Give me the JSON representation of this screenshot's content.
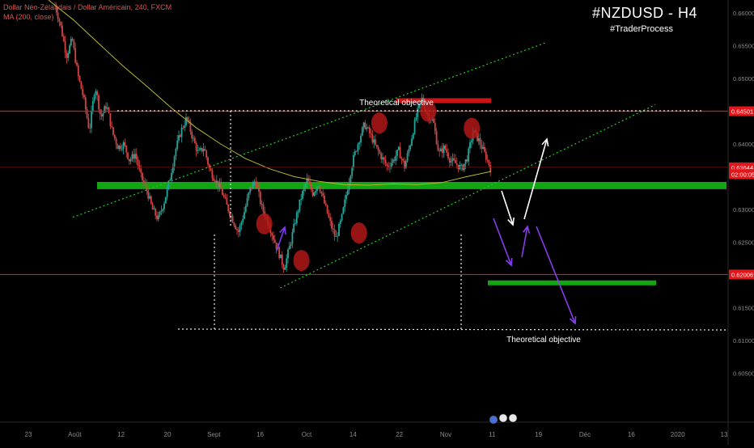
{
  "header": {
    "instrument_line": "Dollar Néo-Zélandais / Dollar Américain, 240, FXCM",
    "indicator_line": "MA (200, close)"
  },
  "watermark": {
    "ticker": "#NZDUSD - H4",
    "handle": "#TraderProcess"
  },
  "annotations": {
    "objective_top": "Theoretical objective",
    "objective_bottom": "Theoretical objective"
  },
  "chart_data": {
    "type": "candlestick",
    "y_range": [
      0.5975,
      0.662
    ],
    "y_ticks": [
      "0.66000",
      "0.65500",
      "0.65000",
      "0.64000",
      "0.63500",
      "0.63000",
      "0.62500",
      "0.61500",
      "0.61000",
      "0.60500"
    ],
    "price_labels": [
      {
        "text": "0.64501",
        "value": 0.64501,
        "color": "#e0161b"
      },
      {
        "text": "0.63644",
        "value": 0.63644,
        "color": "#e0161b"
      },
      {
        "text": "02:00:05",
        "value": 0.6354,
        "color": "#e0161b"
      },
      {
        "text": "0.62006",
        "value": 0.62006,
        "color": "#e0161b"
      }
    ],
    "x_ticks": [
      "23",
      "Août",
      "12",
      "20",
      "Sept",
      "16",
      "Oct",
      "14",
      "22",
      "Nov",
      "11",
      "19",
      "Déc",
      "16",
      "2020",
      "13"
    ],
    "horizontal_lines": [
      {
        "value": 0.64501,
        "color": "#e0161b"
      },
      {
        "value": 0.62006,
        "color": "#e0161b"
      }
    ],
    "zones": [
      {
        "label": "support-zone",
        "y_top": 0.6342,
        "y_bottom": 0.6331,
        "color": "#14b814"
      },
      {
        "label": "resistance-target",
        "y_top": 0.647,
        "y_bottom": 0.6464,
        "color": "#e0161b"
      },
      {
        "label": "support-target",
        "y_top": 0.61915,
        "y_bottom": 0.61865,
        "color": "#14b814"
      }
    ],
    "trend_lines": [
      {
        "name": "upper-channel",
        "from": [
          0.1,
          0.6288
        ],
        "to": [
          0.75,
          0.6555
        ]
      },
      {
        "name": "lower-channel",
        "from": [
          0.385,
          0.618
        ],
        "to": [
          0.9,
          0.646
        ]
      }
    ],
    "ma_series": [
      0.662,
      0.659,
      0.6555,
      0.652,
      0.6488,
      0.6455,
      0.6425,
      0.64,
      0.6378,
      0.6362,
      0.635,
      0.6343,
      0.6338,
      0.6337,
      0.6339,
      0.6338,
      0.6341,
      0.635,
      0.6358
    ],
    "candles_path": [
      0.6612,
      0.658,
      0.6535,
      0.656,
      0.6505,
      0.647,
      0.642,
      0.649,
      0.644,
      0.646,
      0.6418,
      0.6395,
      0.64,
      0.6375,
      0.6385,
      0.635,
      0.633,
      0.63,
      0.6285,
      0.631,
      0.6345,
      0.639,
      0.642,
      0.644,
      0.641,
      0.6385,
      0.6395,
      0.636,
      0.6345,
      0.633,
      0.6305,
      0.6285,
      0.6265,
      0.6295,
      0.633,
      0.6345,
      0.6305,
      0.6285,
      0.626,
      0.6235,
      0.621,
      0.6245,
      0.6285,
      0.632,
      0.6345,
      0.6325,
      0.634,
      0.631,
      0.628,
      0.6255,
      0.6285,
      0.633,
      0.6375,
      0.6405,
      0.643,
      0.6415,
      0.6395,
      0.638,
      0.6365,
      0.6375,
      0.639,
      0.6365,
      0.64,
      0.644,
      0.647,
      0.6445,
      0.6435,
      0.6385,
      0.6395,
      0.6375,
      0.637,
      0.6362,
      0.638,
      0.642,
      0.6405,
      0.6385,
      0.6364
    ],
    "circles": [
      {
        "x": 0.363,
        "y": 0.6278
      },
      {
        "x": 0.414,
        "y": 0.6222
      },
      {
        "x": 0.493,
        "y": 0.6264
      },
      {
        "x": 0.521,
        "y": 0.6432
      },
      {
        "x": 0.588,
        "y": 0.645
      },
      {
        "x": 0.648,
        "y": 0.6424
      }
    ]
  }
}
